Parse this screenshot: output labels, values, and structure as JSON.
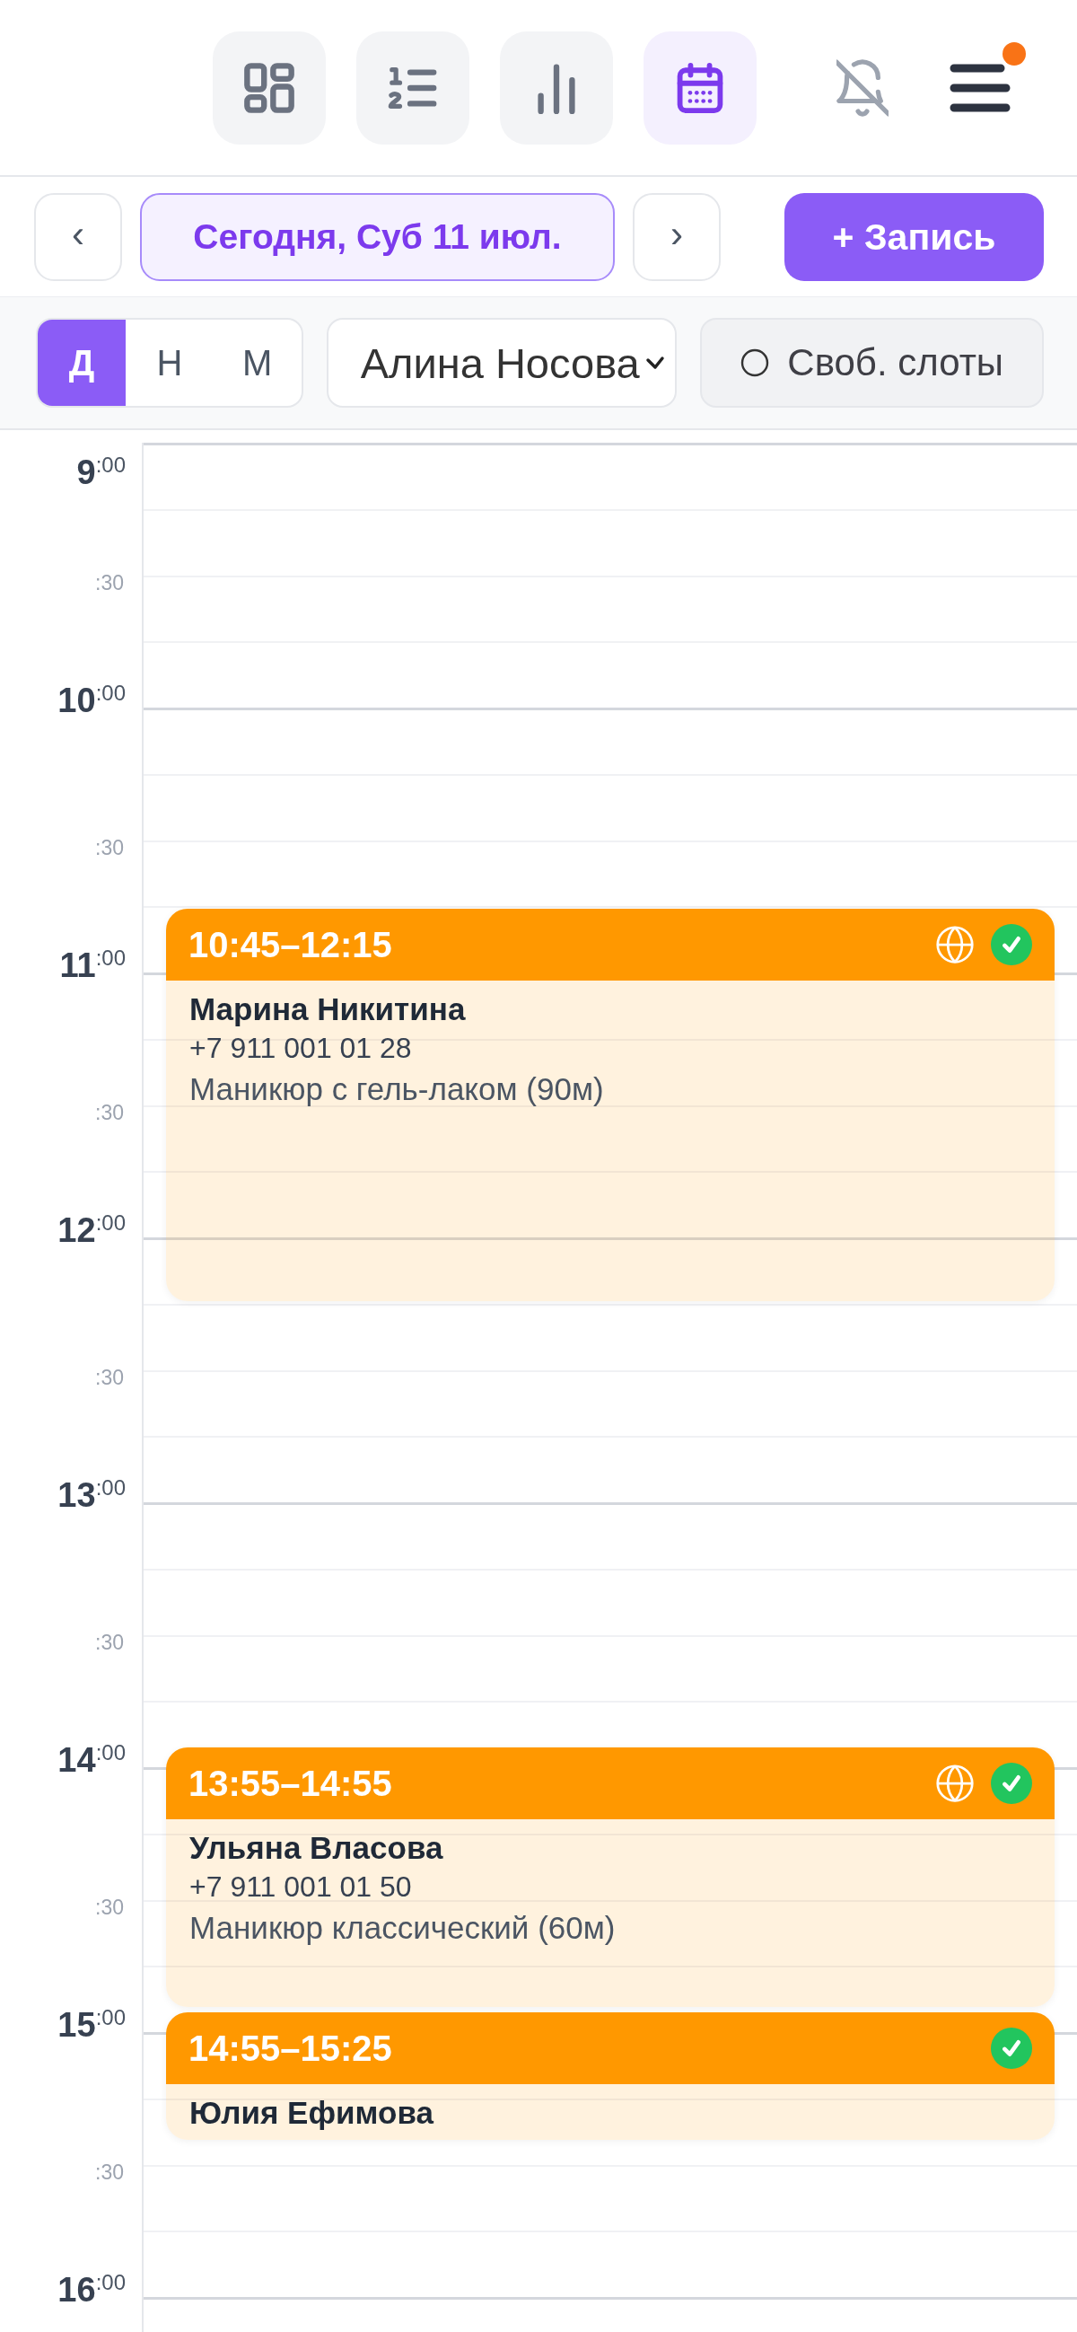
{
  "nav": [
    {
      "kind": "grid",
      "selected": false
    },
    {
      "kind": "list",
      "selected": false
    },
    {
      "kind": "chart",
      "selected": false
    },
    {
      "kind": "calendar",
      "selected": true
    }
  ],
  "notifications": {
    "muted": true
  },
  "menu": {
    "has_unread": true
  },
  "date_nav": {
    "prev": "‹",
    "date": "Сегодня, Суб 11 июл.",
    "next": "›"
  },
  "add_button": "+ Запись",
  "view_modes": [
    {
      "label": "Д",
      "selected": true
    },
    {
      "label": "Н",
      "selected": false
    },
    {
      "label": "М",
      "selected": false
    }
  ],
  "staff_select": {
    "value": "Алина Носова"
  },
  "free_slots": {
    "label": "Своб. слоты",
    "checked": false
  },
  "timeline": {
    "hours": [
      {
        "label": "9$^{:00}$",
        "half": ":30"
      },
      {
        "label": "10$^{:00}$",
        "half": ":30"
      },
      {
        "label": "11$^{:00}$",
        "half": ":30"
      },
      {
        "label": "12$^{:00}$",
        "half": ":30"
      },
      {
        "label": "13$^{:00}$",
        "half": ":30"
      },
      {
        "label": "14$^{:00}$",
        "half": ":30"
      },
      {
        "label": "15$^{:00}$",
        "half": ":30"
      },
      {
        "label": "16$^{:00}$"
      }
    ],
    "events": [
      {
        "time": "10:45–12:15",
        "online": true,
        "confirmed": true,
        "client": "Марина Никитина",
        "phone": "+7 911 001 01 28",
        "service": "Маникюр с гель-лаком (90м)"
      },
      {
        "time": "13:55–14:55",
        "online": true,
        "confirmed": true,
        "client": "Ульяна Власова",
        "phone": "+7 911 001 01 50",
        "service": "Маникюр классический (60м)"
      },
      {
        "time": "14:55–15:25",
        "online": false,
        "confirmed": true,
        "client": "Юлия Ефимова"
      }
    ]
  }
}
